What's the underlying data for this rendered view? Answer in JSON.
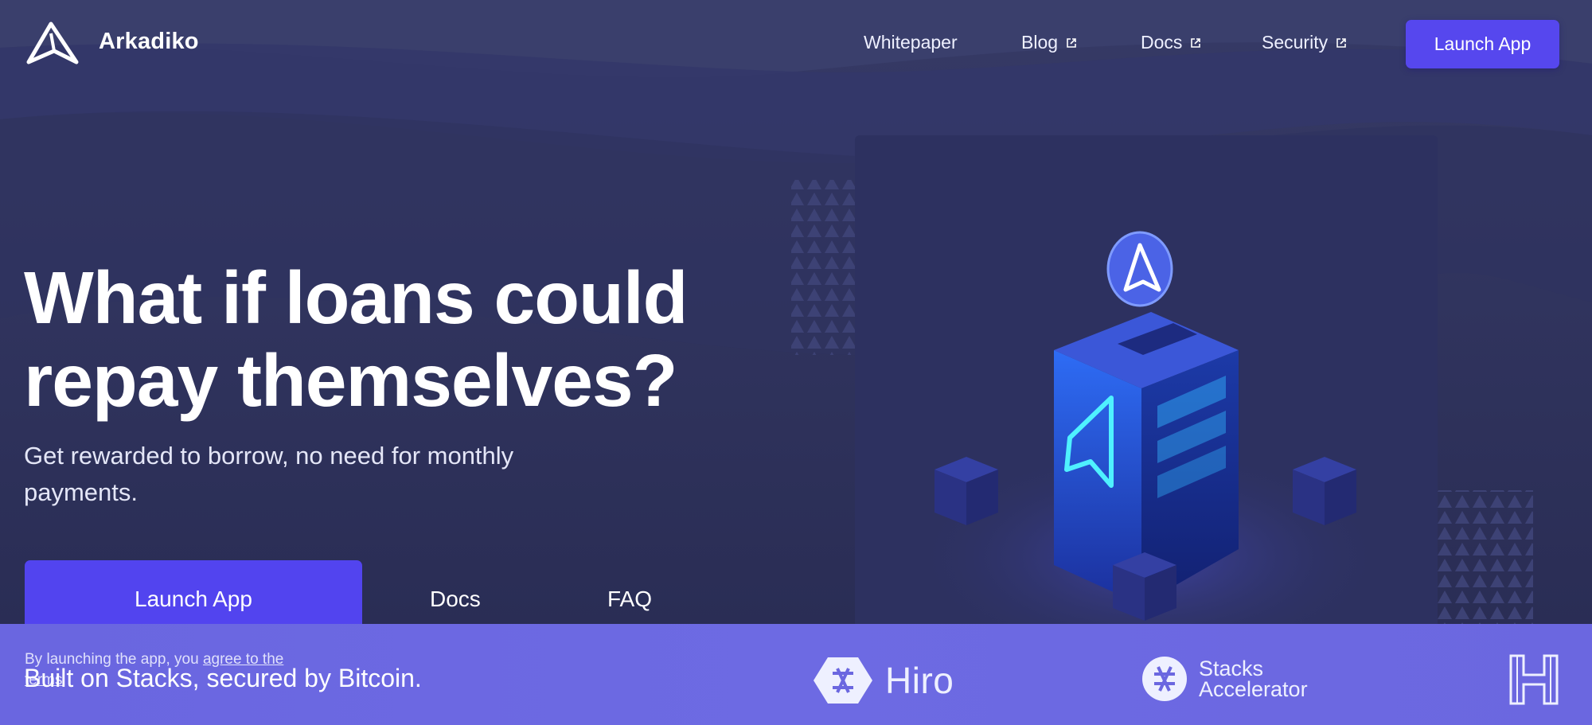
{
  "header": {
    "brand": "Arkadiko",
    "nav": [
      {
        "label": "Whitepaper",
        "external": false
      },
      {
        "label": "Blog",
        "external": true
      },
      {
        "label": "Docs",
        "external": true
      },
      {
        "label": "Security",
        "external": true
      }
    ],
    "cta_label": "Launch App"
  },
  "hero": {
    "headline_line1": "What if loans could",
    "headline_line2": "repay themselves?",
    "subtitle_line1": "Get rewarded to borrow, no need for monthly",
    "subtitle_line2": "payments.",
    "primary_cta": "Launch App",
    "secondary_links": [
      "Docs",
      "FAQ"
    ],
    "disclaimer_prefix": "By launching the app, you ",
    "disclaimer_link": "agree to the",
    "disclaimer_suffix": "terms"
  },
  "footer": {
    "tagline": "Built on Stacks, secured by Bitcoin.",
    "partners": [
      {
        "name": "Hiro",
        "icon": "hiro-icon"
      },
      {
        "name_line1": "Stacks",
        "name_line2": "Accelerator",
        "icon": "stacks-icon"
      }
    ],
    "corner_icon": "h-logo-icon"
  },
  "colors": {
    "background": "#2b2f57",
    "accent": "#5547ee",
    "footer_band": "#6b67e0",
    "illustration_blue": "#2f6bff"
  }
}
